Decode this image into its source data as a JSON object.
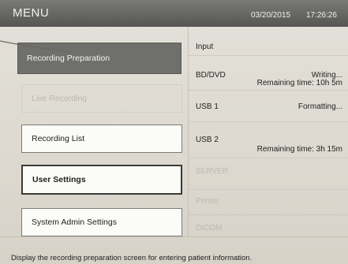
{
  "header": {
    "title": "MENU",
    "date": "03/20/2015",
    "time": "17:26:26"
  },
  "menu": {
    "recording_preparation": "Recording Preparation",
    "live_recording": "Live Recording",
    "recording_list": "Recording List",
    "user_settings": "User Settings",
    "system_admin_settings": "System Admin Settings"
  },
  "status": {
    "input": {
      "label": "Input"
    },
    "bd_dvd": {
      "label": "BD/DVD",
      "status": "Writing...",
      "remaining": "Remaining time: 10h 5m"
    },
    "usb1": {
      "label": "USB 1",
      "status": "Formatting..."
    },
    "usb2": {
      "label": "USB 2",
      "remaining": "Remaining time: 3h 15m"
    },
    "server": {
      "label": "SERVER"
    },
    "printer": {
      "label": "Printer"
    },
    "dicom": {
      "label": "DICOM"
    }
  },
  "footer": {
    "message": "Display the recording preparation screen for entering patient information."
  }
}
